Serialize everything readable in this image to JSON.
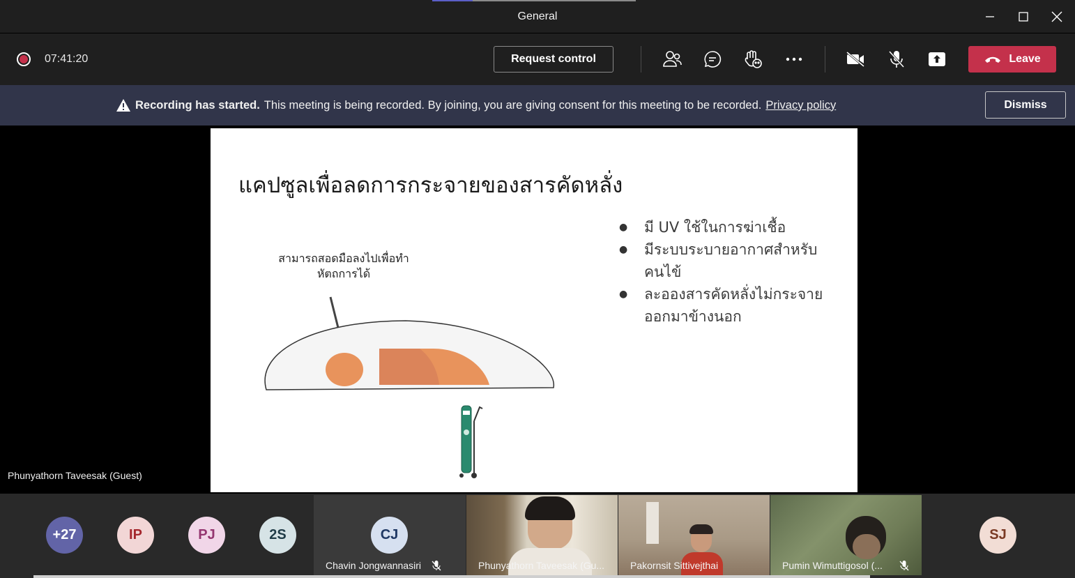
{
  "window": {
    "title": "General"
  },
  "toolbar": {
    "timer": "07:41:20",
    "request_control_label": "Request control",
    "leave_label": "Leave",
    "icons": [
      "people-icon",
      "chat-icon",
      "raise-hand-icon",
      "more-icon",
      "camera-off-icon",
      "mic-off-icon",
      "share-icon"
    ]
  },
  "banner": {
    "bold_text": "Recording has started.",
    "text": "This meeting is being recorded. By joining, you are giving consent for this meeting to be recorded.",
    "link_text": "Privacy policy",
    "dismiss_label": "Dismiss"
  },
  "stage": {
    "presenter_label": "Phunyathorn Taveesak (Guest)",
    "slide": {
      "title": "แคปซูลเพื่อลดการกระจายของสารคัดหลั่ง",
      "callout_line1": "สามารถสอดมือลงไปเพื่อทำ",
      "callout_line2": "หัตถการได้",
      "bullets": [
        "มี UV ใช้ในการฆ่าเชื้อ",
        "มีระบบระบายอากาศสำหรับคนไข้",
        "ละอองสารคัดหลั่งไม่กระจายออกมาข้างนอก"
      ]
    }
  },
  "gallery": {
    "overflow_count": "+27",
    "avatars": [
      {
        "initials": "IP"
      },
      {
        "initials": "PJ"
      },
      {
        "initials": "2S"
      }
    ],
    "tiles": [
      {
        "initials": "CJ",
        "name": "Chavin Jongwannasiri"
      },
      {
        "name": "Phunyathorn Taveesak (Gu..."
      },
      {
        "name": "Pakornsit Sittivejthai"
      },
      {
        "name": "Pumin Wimuttigosol (..."
      },
      {
        "initials": "SJ"
      }
    ]
  },
  "colors": {
    "leave": "#c4314b",
    "banner": "#31354a",
    "accent": "#6264a7",
    "orange": "#e8935c"
  }
}
